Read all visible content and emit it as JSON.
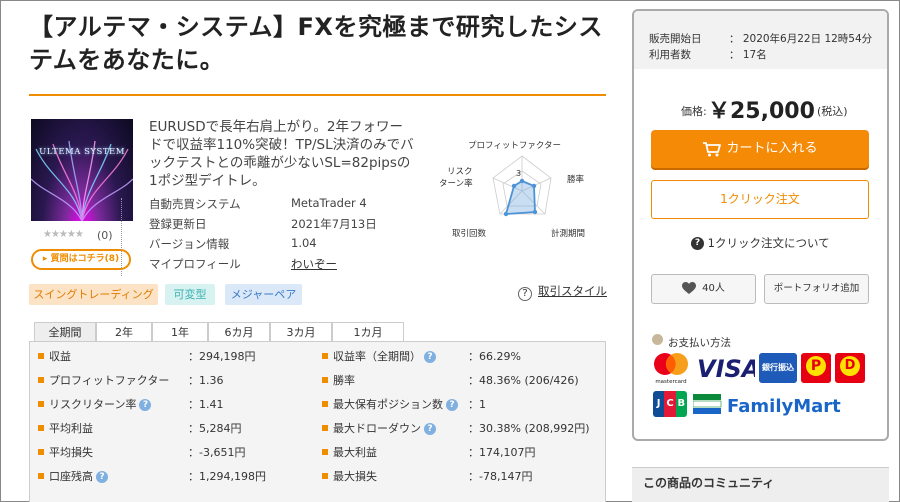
{
  "product": {
    "title": "【アルテマ・システム】FXを究極まで研究したシステムをあなたに。",
    "thumbnail_text": "ULTEMA SYSTEM",
    "rating_stars": "★★★★★",
    "rating_count": "(0)",
    "ask_button": "質問はコチラ(8)",
    "description": "EURUSDで長年右肩上がり。2年フォワードで収益率110%突破！TP/SL決済のみでバックテストとの乖離が少ないSL=82pipsの1ポジ型デイトレ。"
  },
  "info": [
    {
      "key": "自動売買システム",
      "value": "MetaTrader 4"
    },
    {
      "key": "登録更新日",
      "value": "2021年7月13日"
    },
    {
      "key": "バージョン情報",
      "value": "1.04"
    },
    {
      "key": "マイプロフィール",
      "value": "わいぞー"
    }
  ],
  "radar": {
    "labels": [
      "プロフィットファクター",
      "勝率",
      "計測期間",
      "取引回数",
      "リスク",
      "ターン率"
    ],
    "center_value": "3"
  },
  "tags": [
    "スイングトレーディング",
    "可変型",
    "メジャーペア"
  ],
  "tag_colors": {
    "swing": "#fde3c6",
    "swing_text": "#e07b00",
    "var": "#d8f2f2",
    "var_text": "#3ab0b0",
    "major": "#dbe8f7",
    "major_text": "#3a7ac8"
  },
  "trade_style_link": "取引スタイル",
  "period_tabs": [
    "全期間",
    "2年",
    "1年",
    "6カ月",
    "3カ月",
    "1カ月"
  ],
  "stats_left": [
    {
      "label": "収益",
      "value": "：294,198円",
      "help": false
    },
    {
      "label": "プロフィットファクター",
      "value": "：1.36",
      "help": false
    },
    {
      "label": "リスクリターン率",
      "value": "：1.41",
      "help": true
    },
    {
      "label": "平均利益",
      "value": "：5,284円",
      "help": false
    },
    {
      "label": "平均損失",
      "value": "：-3,651円",
      "help": false
    },
    {
      "label": "口座残高",
      "value": "：1,294,198円",
      "help": true
    }
  ],
  "stats_right": [
    {
      "label": "収益率（全期間）",
      "value": "：66.29%",
      "help": true
    },
    {
      "label": "勝率",
      "value": "：48.36% (206/426)",
      "help": false
    },
    {
      "label": "最大保有ポジション数",
      "value": "：1",
      "help": true
    },
    {
      "label": "最大ドローダウン",
      "value": "：30.38% (208,992円)",
      "help": true
    },
    {
      "label": "最大利益",
      "value": "：174,107円",
      "help": false
    },
    {
      "label": "最大損失",
      "value": "：-78,147円",
      "help": false
    }
  ],
  "sidebar": {
    "sale_start_label": "販売開始日",
    "sale_start_value": "：  2020年6月22日 12時54分",
    "users_label": "利用者数",
    "users_value": "：  17名",
    "price_label": "価格:",
    "price": "￥25,000",
    "price_tax": "(税込)",
    "cart_button": "カートに入れる",
    "one_click_button": "1クリック注文",
    "one_click_about": "1クリック注文について",
    "like_count": "40人",
    "portfolio_button": "ポートフォリオ追加",
    "payment_label": "お支払い方法",
    "community_title": "この商品のコミュニティ"
  },
  "payment_logos": [
    "mastercard",
    "VISA",
    "銀行振込",
    "Pay-easy",
    "Daily",
    "JCB",
    "FamilyMart"
  ],
  "colors": {
    "accent": "#f08c00",
    "cart": "#f58a07"
  }
}
